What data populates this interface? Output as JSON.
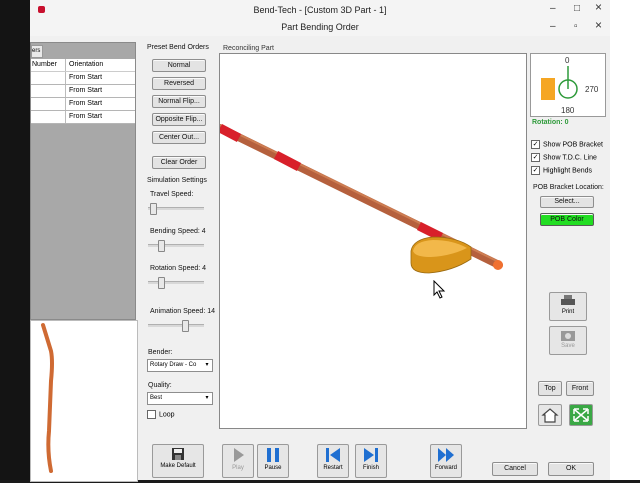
{
  "window": {
    "title": "Bend-Tech - [Custom 3D Part - 1]",
    "subtitle": "Part Bending Order",
    "controls": [
      "minimize",
      "maximize",
      "close"
    ]
  },
  "inner_window_controls": [
    "minimize",
    "restore",
    "close"
  ],
  "table": {
    "tab_text": "ers",
    "headers": [
      "Number",
      "Orientation"
    ],
    "rows": [
      {
        "number": "",
        "orientation": "From Start"
      },
      {
        "number": "",
        "orientation": "From Start"
      },
      {
        "number": "",
        "orientation": "From Start"
      },
      {
        "number": "",
        "orientation": "From Start"
      }
    ]
  },
  "preset": {
    "title": "Preset Bend Orders",
    "buttons": [
      "Normal",
      "Reversed",
      "Normal Flip...",
      "Opposite Flip...",
      "Center Out..."
    ],
    "clear": "Clear Order"
  },
  "simulation": {
    "title": "Simulation Settings",
    "travel_speed": {
      "label": "Travel Speed:",
      "value": 1,
      "max": 20
    },
    "bending_speed": {
      "label": "Bending Speed: 4",
      "value": 4,
      "max": 20
    },
    "rotation_speed": {
      "label": "Rotation Speed: 4",
      "value": 4,
      "max": 20
    },
    "animation_speed": {
      "label": "Animation Speed: 14",
      "value": 14,
      "max": 20
    },
    "bender_label": "Bender:",
    "bender_value": "Rotary Draw - Co",
    "quality_label": "Quality:",
    "quality_value": "Best",
    "loop_label": "Loop",
    "loop_checked": false
  },
  "viewport": {
    "label": "Reconciling Part"
  },
  "rotation": {
    "top": "0",
    "right": "270",
    "bottom": "180",
    "status": "Rotation: 0",
    "accent": "#2e9a3a",
    "part_color": "#f5a623"
  },
  "options": {
    "show_pob_bracket": {
      "label": "Show POB Bracket",
      "checked": true
    },
    "show_tdc_line": {
      "label": "Show T.D.C. Line",
      "checked": true
    },
    "highlight_bends": {
      "label": "Highlight Bends",
      "checked": true
    },
    "pob_location_label": "POB Bracket Location:",
    "select_button": "Select...",
    "pob_color_button": "POB Color",
    "pob_color": "#22dd22"
  },
  "side_buttons": {
    "print": "Print",
    "save": "Save",
    "top": "Top",
    "front": "Front"
  },
  "bottom": {
    "make_default": "Make Default",
    "play": "Play",
    "pause": "Pause",
    "restart": "Restart",
    "finish": "Finish",
    "forward": "Forward",
    "cancel": "Cancel",
    "ok": "OK"
  },
  "colors": {
    "tube": "#c46a45",
    "bend_highlight": "#d8202a",
    "bracket": "#e2a21e"
  }
}
